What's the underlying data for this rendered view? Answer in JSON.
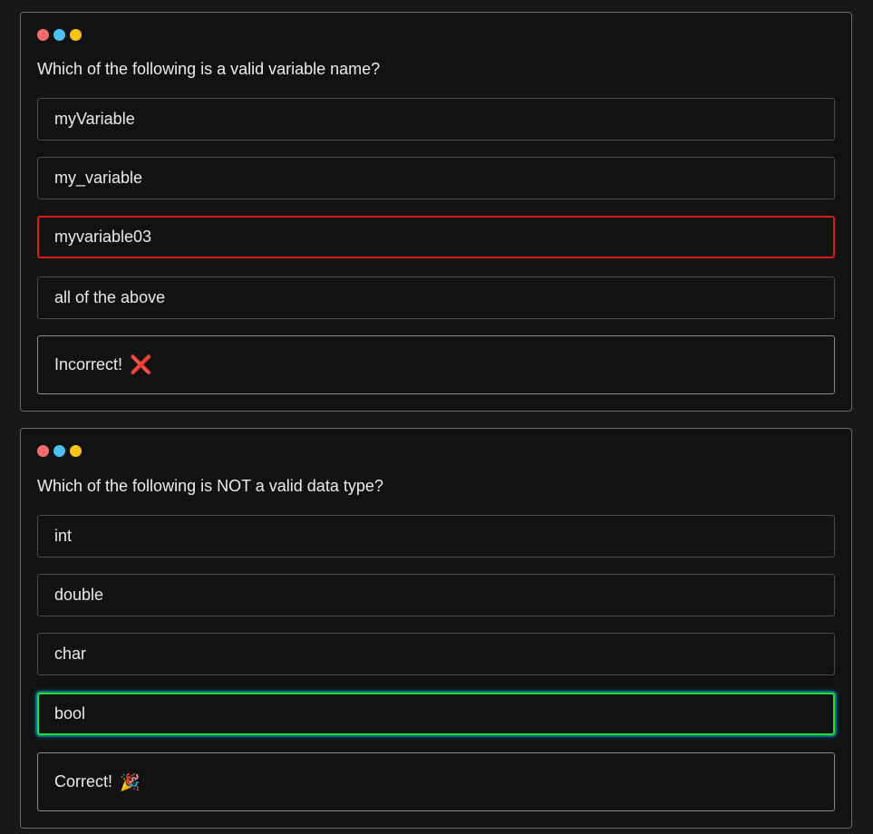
{
  "quiz1": {
    "question": "Which of the following is a valid variable name?",
    "options": [
      "myVariable",
      "my_variable",
      "myvariable03",
      "all of the above"
    ],
    "selected_index": 2,
    "feedback_text": "Incorrect!",
    "feedback_icon": "❌",
    "feedback_icon_name": "cross-mark-icon",
    "result": "incorrect"
  },
  "quiz2": {
    "question": "Which of the following is NOT a valid data type?",
    "options": [
      "int",
      "double",
      "char",
      "bool"
    ],
    "selected_index": 3,
    "feedback_text": "Correct!",
    "feedback_icon": "🎉",
    "feedback_icon_name": "party-popper-icon",
    "result": "correct"
  },
  "colors": {
    "dot_red": "#f56b6b",
    "dot_blue": "#4cc1f1",
    "dot_yellow": "#f5c518",
    "incorrect_border": "#d61c1c",
    "correct_border": "#23e02a"
  }
}
